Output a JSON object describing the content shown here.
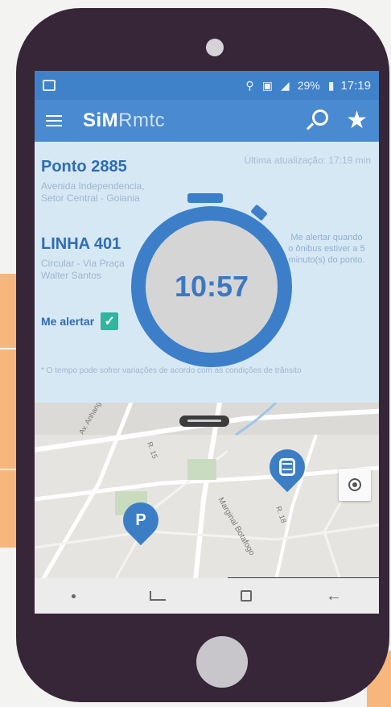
{
  "status_bar": {
    "battery": "29%",
    "time": "17:19"
  },
  "app_bar": {
    "brand_strong": "SiM",
    "brand_light": "Rmtc"
  },
  "stop": {
    "title": "Ponto 2885",
    "address": "Avenida Independencia, Setor Central - Goiania"
  },
  "last_update": "Última atualização: 17:19 min",
  "line": {
    "title": "LINHA 401",
    "description": "Circular - Via Praça Walter Santos"
  },
  "alert": {
    "label": "Me alertar",
    "checked": true,
    "note": "Me alertar quando o ônibus estiver a 5 minuto(s) do ponto."
  },
  "timer": {
    "value": "10:57"
  },
  "disclaimer": "* O tempo pode sofrer variações de acordo com as condições de trânsito",
  "map": {
    "street_labels": [
      "Av. Anhanguera",
      "R. 15",
      "Marginal Botafogo",
      "R. 18"
    ]
  },
  "colors": {
    "primary": "#4a8ad0",
    "accent_check": "#2fb5a0",
    "phone_body": "#362638",
    "decor_orange": "#f7b77c"
  },
  "icons": {
    "menu": "menu-icon",
    "search": "search-icon",
    "favorite": "star-icon",
    "bus_pin": "bus-stop-pin-icon",
    "parking_pin": "parking-pin-icon",
    "locate": "my-location-icon"
  }
}
